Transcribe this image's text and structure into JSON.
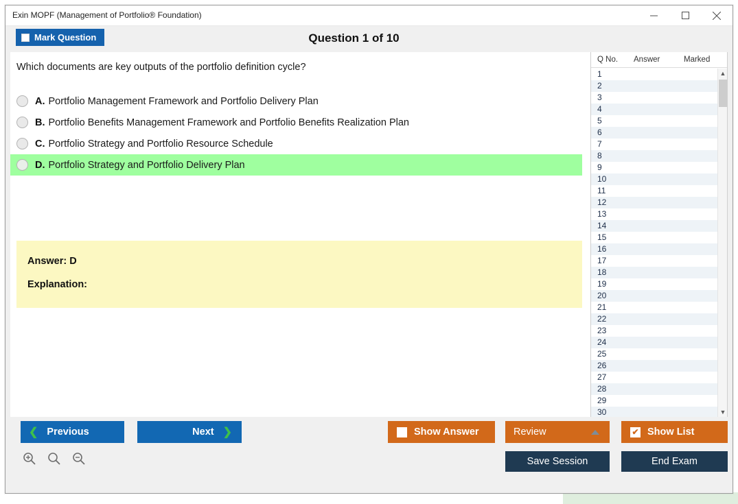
{
  "window": {
    "title": "Exin MOPF (Management of Portfolio® Foundation)",
    "controls": {
      "minimize": "minimize-icon",
      "maximize": "maximize-icon",
      "close": "close-icon"
    }
  },
  "header": {
    "mark_question_label": "Mark Question",
    "mark_question_checked": false,
    "question_counter": "Question 1 of 10"
  },
  "question": {
    "text": "Which documents are key outputs of the portfolio definition cycle?",
    "options": [
      {
        "letter": "A.",
        "text": "Portfolio Management Framework and Portfolio Delivery Plan",
        "correct": false
      },
      {
        "letter": "B.",
        "text": "Portfolio Benefits Management Framework and Portfolio Benefits Realization Plan",
        "correct": false
      },
      {
        "letter": "C.",
        "text": "Portfolio Strategy and Portfolio Resource Schedule",
        "correct": false
      },
      {
        "letter": "D.",
        "text": "Portfolio Strategy and Portfolio Delivery Plan",
        "correct": true
      }
    ]
  },
  "answer_panel": {
    "answer_label": "Answer: D",
    "explanation_label": "Explanation:"
  },
  "question_list": {
    "columns": [
      "Q No.",
      "Answer",
      "Marked"
    ],
    "rows": [
      {
        "no": "1",
        "answer": "",
        "marked": ""
      },
      {
        "no": "2",
        "answer": "",
        "marked": ""
      },
      {
        "no": "3",
        "answer": "",
        "marked": ""
      },
      {
        "no": "4",
        "answer": "",
        "marked": ""
      },
      {
        "no": "5",
        "answer": "",
        "marked": ""
      },
      {
        "no": "6",
        "answer": "",
        "marked": ""
      },
      {
        "no": "7",
        "answer": "",
        "marked": ""
      },
      {
        "no": "8",
        "answer": "",
        "marked": ""
      },
      {
        "no": "9",
        "answer": "",
        "marked": ""
      },
      {
        "no": "10",
        "answer": "",
        "marked": ""
      },
      {
        "no": "11",
        "answer": "",
        "marked": ""
      },
      {
        "no": "12",
        "answer": "",
        "marked": ""
      },
      {
        "no": "13",
        "answer": "",
        "marked": ""
      },
      {
        "no": "14",
        "answer": "",
        "marked": ""
      },
      {
        "no": "15",
        "answer": "",
        "marked": ""
      },
      {
        "no": "16",
        "answer": "",
        "marked": ""
      },
      {
        "no": "17",
        "answer": "",
        "marked": ""
      },
      {
        "no": "18",
        "answer": "",
        "marked": ""
      },
      {
        "no": "19",
        "answer": "",
        "marked": ""
      },
      {
        "no": "20",
        "answer": "",
        "marked": ""
      },
      {
        "no": "21",
        "answer": "",
        "marked": ""
      },
      {
        "no": "22",
        "answer": "",
        "marked": ""
      },
      {
        "no": "23",
        "answer": "",
        "marked": ""
      },
      {
        "no": "24",
        "answer": "",
        "marked": ""
      },
      {
        "no": "25",
        "answer": "",
        "marked": ""
      },
      {
        "no": "26",
        "answer": "",
        "marked": ""
      },
      {
        "no": "27",
        "answer": "",
        "marked": ""
      },
      {
        "no": "28",
        "answer": "",
        "marked": ""
      },
      {
        "no": "29",
        "answer": "",
        "marked": ""
      },
      {
        "no": "30",
        "answer": "",
        "marked": ""
      }
    ],
    "scroll_up": "▲",
    "scroll_down": "▼"
  },
  "footer": {
    "previous_label": "Previous",
    "next_label": "Next",
    "prev_chevron": "❮",
    "next_chevron": "❯",
    "show_answer_label": "Show Answer",
    "show_answer_checked": false,
    "review_label": "Review",
    "show_list_label": "Show List",
    "show_list_checked": true,
    "show_list_check_glyph": "✔",
    "save_session_label": "Save Session",
    "end_exam_label": "End Exam",
    "zoom_in": "zoom-in-icon",
    "zoom_reset": "zoom-reset-icon",
    "zoom_out": "zoom-out-icon"
  },
  "colors": {
    "accent_blue": "#1268b3",
    "accent_orange": "#d2691a",
    "navy": "#1f3a52",
    "correct_green": "#9fff9f",
    "answer_yellow": "#fcf8c2",
    "chevron_green": "#3fc04a"
  }
}
